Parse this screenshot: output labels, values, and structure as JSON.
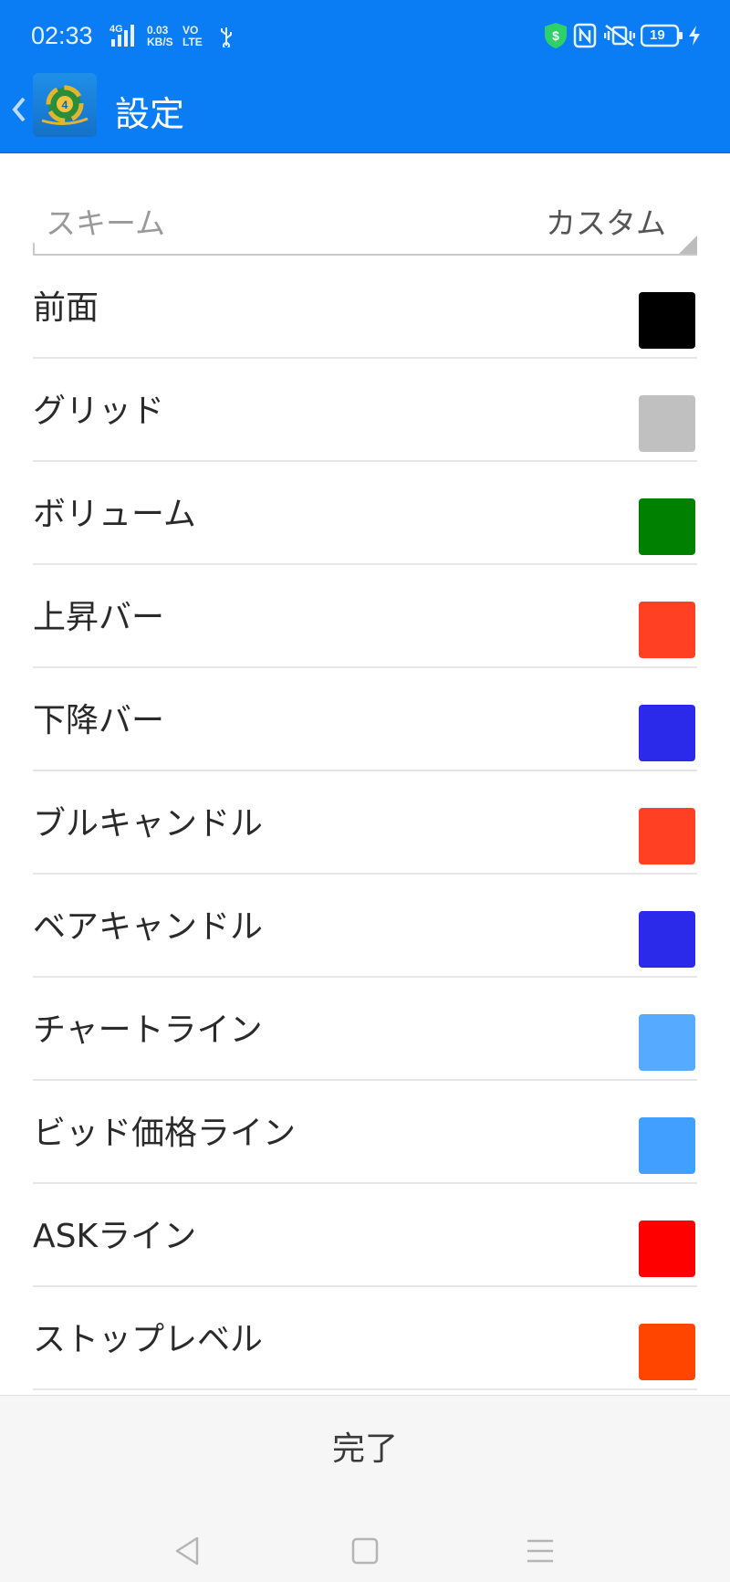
{
  "status_bar": {
    "time": "02:33",
    "network_4g": "4G",
    "speed_value": "0.03",
    "speed_unit": "KB/S",
    "volte_top": "VO",
    "volte_bottom": "LTE",
    "battery": "19"
  },
  "app_bar": {
    "title": "設定"
  },
  "scheme": {
    "label": "スキーム",
    "value": "カスタム"
  },
  "colors": [
    {
      "label": "前面",
      "color": "#000000"
    },
    {
      "label": "グリッド",
      "color": "#c0c0c0"
    },
    {
      "label": "ボリューム",
      "color": "#008000"
    },
    {
      "label": "上昇バー",
      "color": "#ff4023"
    },
    {
      "label": "下降バー",
      "color": "#2b2aea"
    },
    {
      "label": "ブルキャンドル",
      "color": "#ff4023"
    },
    {
      "label": "ベアキャンドル",
      "color": "#2b2aea"
    },
    {
      "label": "チャートライン",
      "color": "#56aaff"
    },
    {
      "label": "ビッド価格ライン",
      "color": "#419fff"
    },
    {
      "label": "ASKライン",
      "color": "#ff0000"
    },
    {
      "label": "ストップレベル",
      "color": "#ff4500"
    }
  ],
  "footer": {
    "done_label": "完了"
  }
}
